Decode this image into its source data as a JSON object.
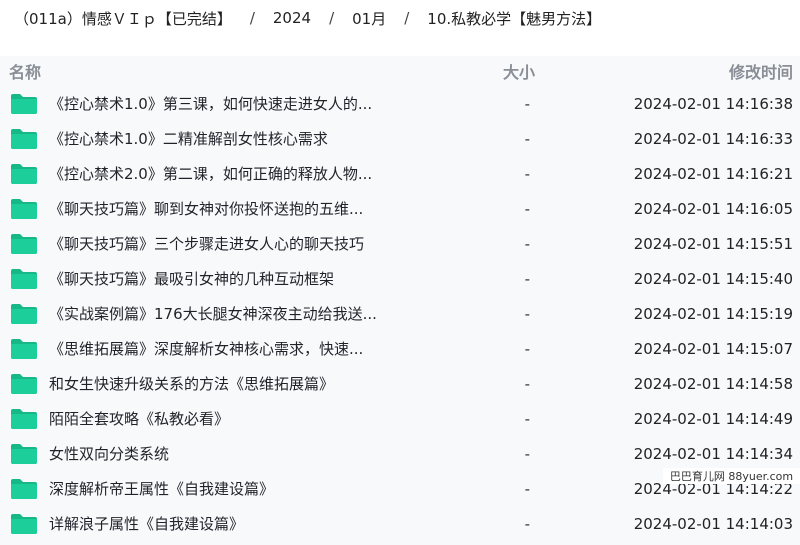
{
  "breadcrumb": {
    "items": [
      "（011a）情感ＶＩｐ【已完结】",
      "2024",
      "01月",
      "10.私教必学【魅男方法】"
    ],
    "separator": "/"
  },
  "columns": {
    "name": "名称",
    "size": "大小",
    "modified": "修改时间"
  },
  "files": [
    {
      "name": "《控心禁术1.0》第三课，如何快速走进女人的...",
      "size": "-",
      "modified": "2024-02-01 14:16:38",
      "icon": "folder-icon"
    },
    {
      "name": "《控心禁术1.0》二精准解剖女性核心需求",
      "size": "-",
      "modified": "2024-02-01 14:16:33",
      "icon": "folder-icon"
    },
    {
      "name": "《控心禁术2.0》第二课，如何正确的释放人物...",
      "size": "-",
      "modified": "2024-02-01 14:16:21",
      "icon": "folder-icon"
    },
    {
      "name": "《聊天技巧篇》聊到女神对你投怀送抱的五维...",
      "size": "-",
      "modified": "2024-02-01 14:16:05",
      "icon": "folder-icon"
    },
    {
      "name": "《聊天技巧篇》三个步骤走进女人心的聊天技巧",
      "size": "-",
      "modified": "2024-02-01 14:15:51",
      "icon": "folder-icon"
    },
    {
      "name": "《聊天技巧篇》最吸引女神的几种互动框架",
      "size": "-",
      "modified": "2024-02-01 14:15:40",
      "icon": "folder-icon"
    },
    {
      "name": "《实战案例篇》176大长腿女神深夜主动给我送...",
      "size": "-",
      "modified": "2024-02-01 14:15:19",
      "icon": "folder-icon"
    },
    {
      "name": "《思维拓展篇》深度解析女神核心需求，快速...",
      "size": "-",
      "modified": "2024-02-01 14:15:07",
      "icon": "folder-icon"
    },
    {
      "name": "和女生快速升级关系的方法《思维拓展篇》",
      "size": "-",
      "modified": "2024-02-01 14:14:58",
      "icon": "folder-icon"
    },
    {
      "name": "陌陌全套攻略《私教必看》",
      "size": "-",
      "modified": "2024-02-01 14:14:49",
      "icon": "folder-icon"
    },
    {
      "name": "女性双向分类系统",
      "size": "-",
      "modified": "2024-02-01 14:14:34",
      "icon": "folder-icon"
    },
    {
      "name": "深度解析帝王属性《自我建设篇》",
      "size": "-",
      "modified": "2024-02-01 14:14:22",
      "icon": "folder-icon"
    },
    {
      "name": "详解浪子属性《自我建设篇》",
      "size": "-",
      "modified": "2024-02-01 14:14:03",
      "icon": "folder-icon"
    }
  ],
  "watermark": "巴巴育儿网 88yuer.com",
  "colors": {
    "folder": "#1ccf9a",
    "folder_dark": "#15b886",
    "header_text": "#8a8f97",
    "list_bg": "#f8f9fb"
  }
}
